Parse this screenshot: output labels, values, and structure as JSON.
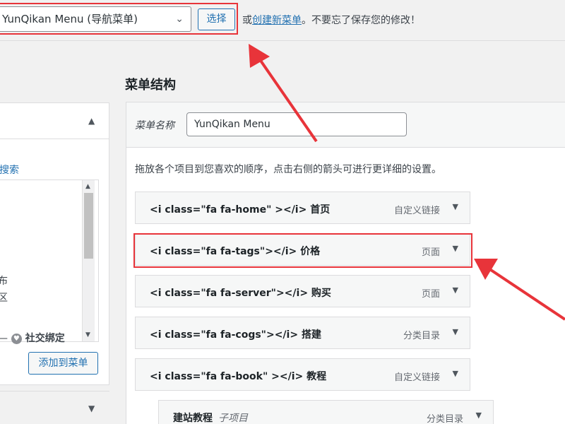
{
  "topbar": {
    "selected_menu": "YunQikan Menu (导航菜单)",
    "select_button": "选择",
    "note_prefix": "或",
    "create_link": "创建新菜单",
    "note_suffix": "。不要忘了保存您的修改！"
  },
  "left": {
    "search_fragment": "搜索",
    "list_fragments": [
      "布",
      "区"
    ],
    "social_dash": "—",
    "social_label": "社交绑定",
    "add_button": "添加到菜单"
  },
  "structure": {
    "title": "菜单结构",
    "name_label": "菜单名称",
    "name_value": "YunQikan Menu",
    "instruction": "拖放各个项目到您喜欢的顺序，点击右侧的箭头可进行更详细的设置。",
    "items": [
      {
        "label": "<i class=\"fa fa-home\" ></i> 首页",
        "type": "自定义链接"
      },
      {
        "label": "<i class=\"fa fa-tags\"></i> 价格",
        "type": "页面"
      },
      {
        "label": "<i class=\"fa fa-server\"></i> 购买",
        "type": "页面"
      },
      {
        "label": "<i class=\"fa fa-cogs\"></i> 搭建",
        "type": "分类目录"
      },
      {
        "label": "<i class=\"fa fa-book\" ></i> 教程",
        "type": "自定义链接"
      }
    ],
    "subitem": {
      "label": "建站教程",
      "sub_label": "子项目",
      "type": "分类目录"
    }
  },
  "icons": {
    "chevron": "chevron-down-icon",
    "collapse": "triangle-up-icon",
    "item_toggle": "triangle-down-icon",
    "social": "social-badge-icon"
  },
  "colors": {
    "accent": "#2271b1",
    "highlight": "#e8343a"
  }
}
